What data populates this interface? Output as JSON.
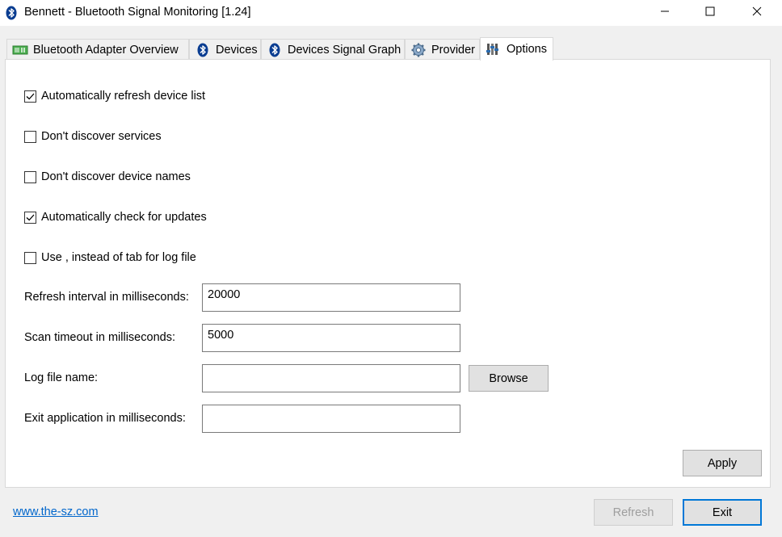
{
  "window": {
    "title": "Bennett - Bluetooth Signal Monitoring [1.24]",
    "icon": "bluetooth-icon"
  },
  "tabs": [
    {
      "label": "Bluetooth Adapter Overview",
      "icon": "adapter-card-icon"
    },
    {
      "label": "Devices",
      "icon": "bluetooth-icon"
    },
    {
      "label": "Devices Signal Graph",
      "icon": "bluetooth-icon"
    },
    {
      "label": "Provider",
      "icon": "gear-icon"
    },
    {
      "label": "Options",
      "icon": "options-icon",
      "active": true
    }
  ],
  "options": {
    "checkboxes": [
      {
        "label": "Automatically refresh device list",
        "checked": true
      },
      {
        "label": "Don't discover services",
        "checked": false
      },
      {
        "label": "Don't discover device names",
        "checked": false
      },
      {
        "label": "Automatically check for updates",
        "checked": true
      },
      {
        "label": "Use , instead of tab for log file",
        "checked": false
      }
    ],
    "fields": {
      "refresh_interval": {
        "label": "Refresh interval in milliseconds:",
        "value": "20000"
      },
      "scan_timeout": {
        "label": "Scan timeout in milliseconds:",
        "value": "5000"
      },
      "log_file": {
        "label": "Log file name:",
        "value": ""
      },
      "exit_application": {
        "label": "Exit application in milliseconds:",
        "value": ""
      }
    },
    "browse_label": "Browse",
    "apply_label": "Apply"
  },
  "footer": {
    "link": "www.the-sz.com",
    "refresh_label": "Refresh",
    "exit_label": "Exit"
  },
  "colors": {
    "accent": "#0078d7",
    "link": "#0066cc",
    "bluetooth": "#0a3d91"
  }
}
